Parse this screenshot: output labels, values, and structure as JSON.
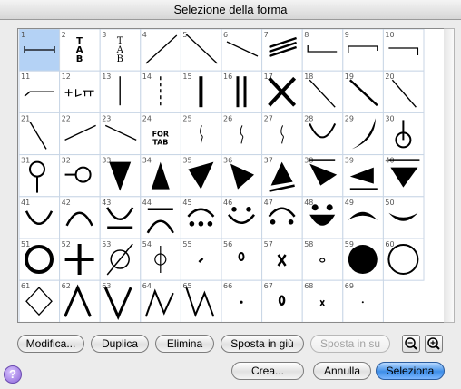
{
  "window": {
    "title": "Selezione della forma"
  },
  "shapes": {
    "columns": 10,
    "selected_index": 0,
    "cells": [
      "1",
      "2",
      "3",
      "4",
      "5",
      "6",
      "7",
      "8",
      "9",
      "10",
      "11",
      "12",
      "13",
      "14",
      "15",
      "16",
      "17",
      "18",
      "19",
      "20",
      "21",
      "22",
      "23",
      "24",
      "25",
      "26",
      "27",
      "28",
      "29",
      "30",
      "31",
      "32",
      "33",
      "34",
      "35",
      "36",
      "37",
      "38",
      "39",
      "40",
      "41",
      "42",
      "43",
      "44",
      "45",
      "46",
      "47",
      "48",
      "49",
      "50",
      "51",
      "52",
      "53",
      "54",
      "55",
      "56",
      "57",
      "58",
      "59",
      "60",
      "61",
      "62",
      "63",
      "64",
      "65",
      "66",
      "67",
      "68",
      "69"
    ]
  },
  "glyphs": {
    "tab_stacked": [
      "T",
      "A",
      "B"
    ],
    "for_tab": [
      "FOR",
      "TAB"
    ]
  },
  "buttons": {
    "modifica": "Modifica...",
    "duplica": "Duplica",
    "elimina": "Elimina",
    "sposta_giu": "Sposta in giù",
    "sposta_su": "Sposta in su",
    "crea": "Crea...",
    "annulla": "Annulla",
    "seleziona": "Seleziona"
  },
  "help": {
    "label": "?"
  },
  "icons": {
    "zoom_out": "zoom-out-icon",
    "zoom_in": "zoom-in-icon",
    "help": "help-icon"
  }
}
